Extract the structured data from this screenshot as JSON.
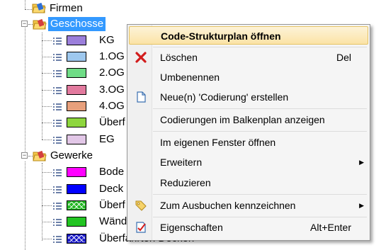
{
  "tree": {
    "firmen": {
      "label": "Firmen"
    },
    "geschosse": {
      "label": "Geschosse",
      "expander": "−",
      "items": [
        {
          "label": "KG",
          "color": "#9b7fdb"
        },
        {
          "label": "1.OG",
          "color": "#9ec8ee"
        },
        {
          "label": "2.OG",
          "color": "#6fdc86"
        },
        {
          "label": "3.OG",
          "color": "#e27a9e"
        },
        {
          "label": "4.OG",
          "color": "#e8a07c"
        },
        {
          "label": "Überf",
          "color": "#8ed63e"
        },
        {
          "label": "EG",
          "color": "#e2c7e7"
        }
      ]
    },
    "gewerke": {
      "label": "Gewerke",
      "expander": "−",
      "items": [
        {
          "label": "Bode",
          "color": "#ff00ff"
        },
        {
          "label": "Deck",
          "color": "#0000ff"
        },
        {
          "label": "Überf",
          "color": "#22b822"
        },
        {
          "label": "Wänd",
          "color": "#22c422"
        },
        {
          "label": "Überfahrten Decken",
          "color": "#1818c8"
        }
      ]
    }
  },
  "menu": {
    "items": [
      {
        "label": "Code-Strukturplan öffnen",
        "bold": true,
        "highlighted": true,
        "icon": ""
      },
      {
        "label": "Löschen",
        "shortcut": "Del",
        "icon": "delete-x-icon"
      },
      {
        "label": "Umbenennen",
        "icon": ""
      },
      {
        "label": "Neue(n) 'Codierung' erstellen",
        "icon": "new-document-icon"
      },
      {
        "label": "Codierungen im Balkenplan anzeigen",
        "icon": ""
      },
      {
        "label": "Im  eigenen Fenster öffnen",
        "icon": ""
      },
      {
        "label": "Erweitern",
        "submenu_arrow": "▶",
        "icon": ""
      },
      {
        "label": "Reduzieren",
        "icon": ""
      },
      {
        "label": "Zum Ausbuchen kennzeichnen",
        "submenu_arrow": "▶",
        "icon": "tag-icon"
      },
      {
        "label": "Eigenschaften",
        "shortcut": "Alt+Enter",
        "icon": "properties-icon"
      }
    ]
  }
}
